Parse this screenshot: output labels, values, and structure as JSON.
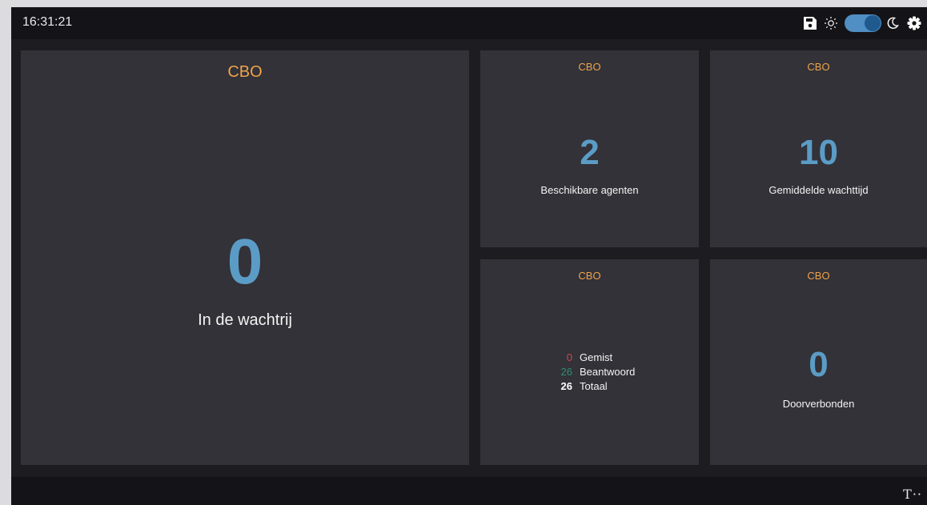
{
  "header": {
    "clock": "16:31:21",
    "theme_mode": "dark",
    "icons": [
      "save-icon",
      "sun-icon",
      "theme-toggle",
      "moon-icon",
      "gear-icon"
    ]
  },
  "tiles": {
    "queue": {
      "title": "CBO",
      "value": "0",
      "label": "In de wachtrij"
    },
    "agents": {
      "title": "CBO",
      "value": "2",
      "label": "Beschikbare agenten"
    },
    "wait": {
      "title": "CBO",
      "value": "10",
      "label": "Gemiddelde wachttijd"
    },
    "stats": {
      "title": "CBO",
      "rows": [
        {
          "value": "0",
          "label": "Gemist",
          "color": "#c84a4a"
        },
        {
          "value": "26",
          "label": "Beantwoord",
          "color": "#2e8f73"
        },
        {
          "value": "26",
          "label": "Totaal",
          "color": "#ffffff"
        }
      ]
    },
    "transfer": {
      "title": "CBO",
      "value": "0",
      "label": "Doorverbonden"
    }
  },
  "footer": {
    "logo_text": "T··"
  },
  "colors": {
    "accent_title": "#f0a14a",
    "value_blue": "#5b9cc6",
    "tile_bg": "#323238",
    "app_bg": "#1d1d21",
    "bar_bg": "#141418"
  }
}
